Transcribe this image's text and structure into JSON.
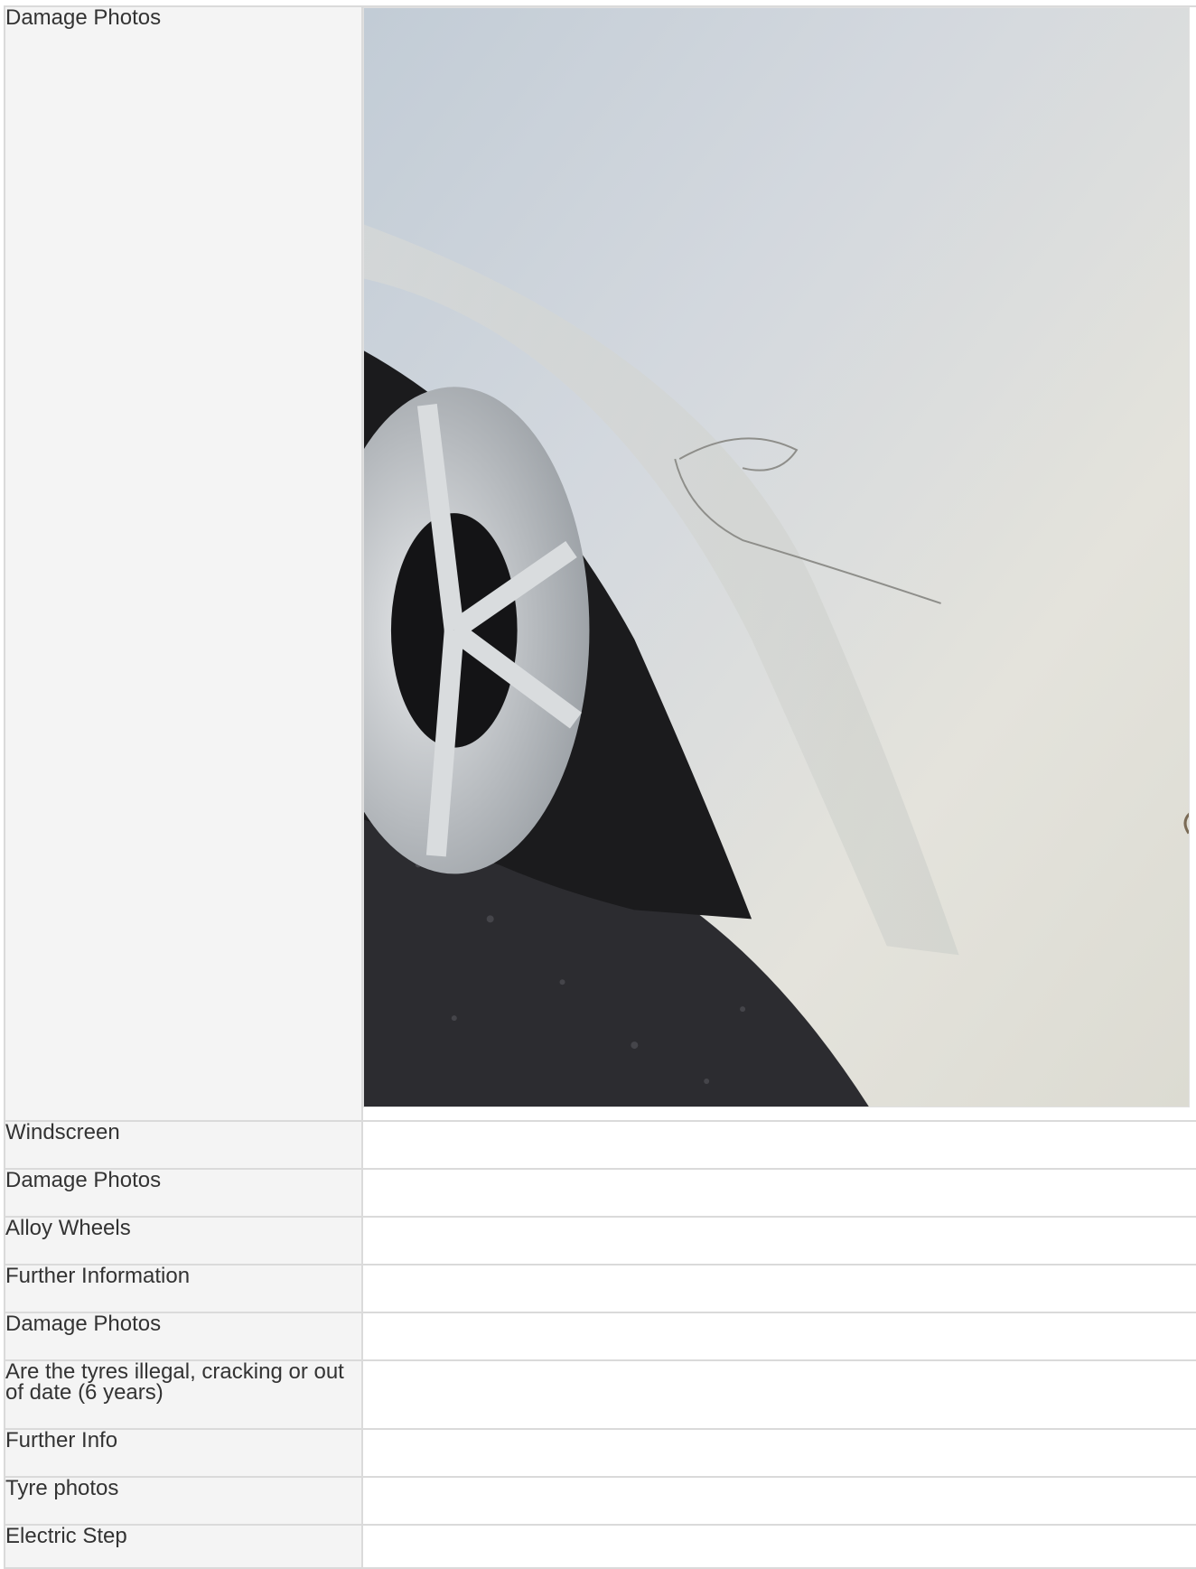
{
  "rows": [
    {
      "label": "Damage Photos"
    },
    {
      "label": "Windscreen",
      "value": ""
    },
    {
      "label": "Damage Photos",
      "value": ""
    },
    {
      "label": "Alloy Wheels",
      "value": ""
    },
    {
      "label": "Further Information",
      "value": ""
    },
    {
      "label": "Damage Photos",
      "value": ""
    },
    {
      "label": "Are the tyres illegal, cracking or out of date (6 years)",
      "value": ""
    },
    {
      "label": "Further Info",
      "value": ""
    },
    {
      "label": "Tyre photos",
      "value": ""
    },
    {
      "label": "Electric Step",
      "value": ""
    }
  ]
}
